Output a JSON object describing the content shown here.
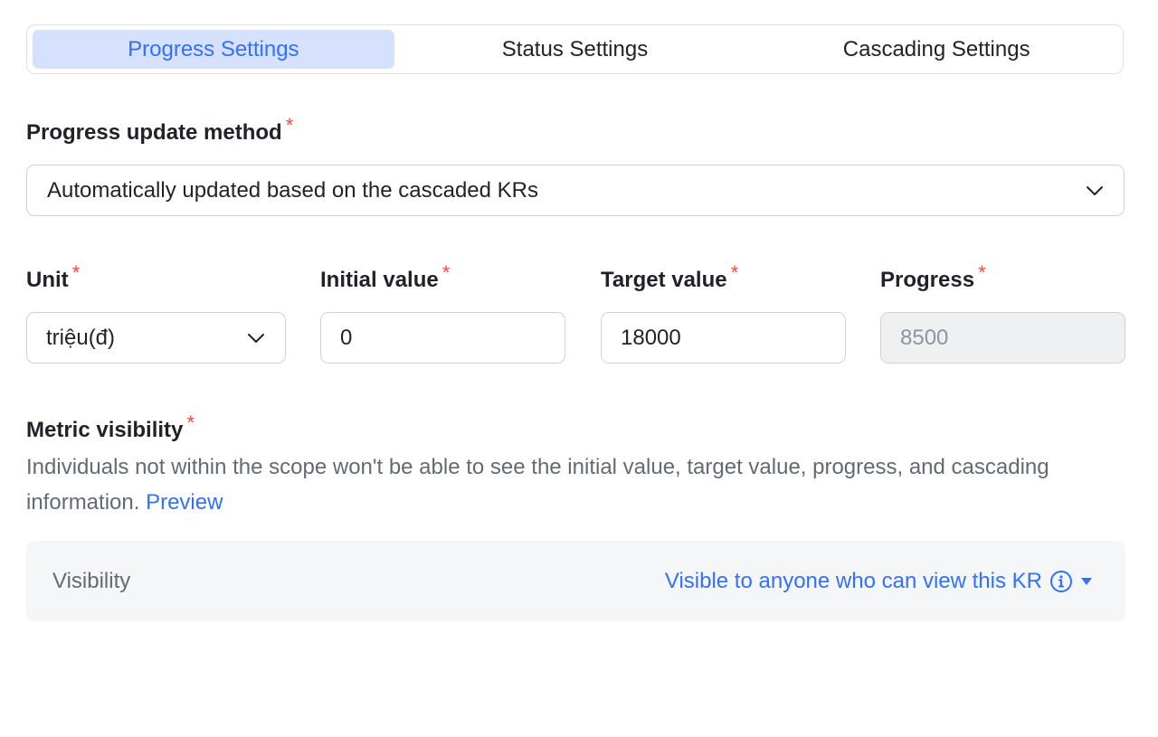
{
  "tabs": [
    {
      "label": "Progress Settings",
      "active": true
    },
    {
      "label": "Status Settings",
      "active": false
    },
    {
      "label": "Cascading Settings",
      "active": false
    }
  ],
  "progress_method": {
    "label": "Progress update method",
    "required_mark": "*",
    "value": "Automatically updated based on the cascaded KRs"
  },
  "unit": {
    "label": "Unit",
    "required_mark": "*",
    "value": "triệu(đ)"
  },
  "initial_value": {
    "label": "Initial value",
    "required_mark": "*",
    "value": "0"
  },
  "target_value": {
    "label": "Target value",
    "required_mark": "*",
    "value": "18000"
  },
  "progress": {
    "label": "Progress",
    "required_mark": "*",
    "value": "8500"
  },
  "metric_visibility": {
    "label": "Metric visibility",
    "required_mark": "*",
    "description": "Individuals not within the scope won't be able to see the initial value, target value, progress, and cascading information.",
    "preview_link": "Preview",
    "visibility_label": "Visibility",
    "visibility_value": "Visible to anyone who can view this KR",
    "info_icon": "info-circle-icon",
    "dropdown_icon": "caret-down-icon"
  },
  "colors": {
    "accent": "#3370ff",
    "active_tab_bg": "#d5e1fd",
    "required": "#f54a45",
    "muted_text": "#646a73",
    "disabled_bg": "#eff0f1"
  }
}
